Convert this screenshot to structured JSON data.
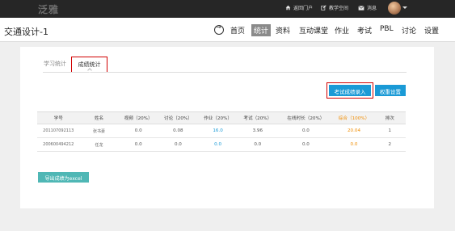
{
  "topbar": {
    "brand": "泛雅",
    "portal_label": "返回门户",
    "space_label": "教学空间",
    "messages_label": "消息"
  },
  "header": {
    "course_title": "交通设计-1",
    "nav": [
      "首页",
      "统计",
      "资料",
      "互动课堂",
      "作业",
      "考试",
      "PBL",
      "讨论",
      "设置"
    ],
    "active_nav": "统计"
  },
  "tabs": {
    "learning": "学习统计",
    "score": "成绩统计"
  },
  "buttons": {
    "exam_import": "考试成绩录入",
    "weight_settings": "权重设置",
    "export_excel": "导出成绩为excel"
  },
  "table": {
    "headers": [
      "学号",
      "姓名",
      "视频（20%）",
      "讨论（20%）",
      "作业（20%）",
      "考试（20%）",
      "在线时长（20%）",
      "综合（100%）",
      "排次"
    ],
    "rows": [
      [
        "201107092113",
        "张书豪",
        "0.0",
        "0.08",
        "16.0",
        "3.96",
        "0.0",
        "20.04",
        "1"
      ],
      [
        "200600494212",
        "任龙",
        "0.0",
        "0.0",
        "0.0",
        "0.0",
        "0.0",
        "0.0",
        "2"
      ]
    ]
  },
  "colors": {
    "accent_blue": "#1a9ad6",
    "highlight_orange": "#f08c00",
    "annotation_red": "#d10000",
    "export_teal": "#4fb7b5",
    "topbar": "#262626"
  }
}
